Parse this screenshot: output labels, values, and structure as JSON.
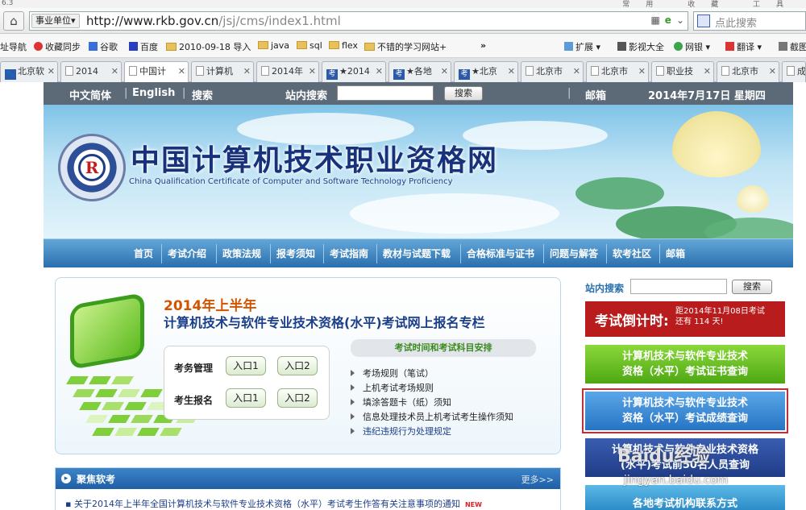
{
  "browser": {
    "top_strip_left": "6.3",
    "top_strip_right": "常用 收藏 工具",
    "zone_label": "事业单位",
    "url_host": "http://www.rkb.gov.cn",
    "url_path": "/jsj/cms/index1.html",
    "search_placeholder": "点此搜索",
    "bookmarks": [
      "址导航",
      "收藏同步",
      "谷歌",
      "百度",
      "2010-09-18 导入",
      "java",
      "sql",
      "flex",
      "不错的学习网站+",
      "»",
      "扩展",
      "影视大全",
      "网银",
      "翻译",
      "截图"
    ],
    "tabs": [
      "北京软",
      "2014",
      "中国计",
      "计算机",
      "2014年",
      "★2014",
      "★各地",
      "★北京",
      "北京市",
      "北京市",
      "职业技",
      "北京市",
      "成"
    ]
  },
  "site": {
    "top": {
      "lang_cn": "中文简体",
      "lang_en": "English",
      "search_link": "搜索",
      "search_label": "站内搜索",
      "search_btn": "搜索",
      "mail": "邮箱",
      "date": "2014年7月17日  星期四"
    },
    "banner": {
      "title": "中国计算机技术职业资格网",
      "subtitle": "China Qualification Certificate of Computer and Software Technology Proficiency",
      "logo_letter": "R"
    },
    "nav": [
      "首页",
      "考试介绍",
      "政策法规",
      "报考须知",
      "考试指南",
      "教材与试题下载",
      "合格标准与证书",
      "问题与解答",
      "软考社区",
      "邮箱"
    ],
    "promo": {
      "year": "2014年上半年",
      "title": "计算机技术与软件专业技术资格(水平)考试网上报名专栏",
      "row1_label": "考务管理",
      "row2_label": "考生报名",
      "entry1": "入口1",
      "entry2": "入口2",
      "schedule": "考试时间和考试科目安排",
      "list": [
        "考场规则（笔试）",
        "上机考试考场规则",
        "填涂答题卡（纸）须知",
        "信息处理技术员上机考试考生操作须知",
        "违纪违规行为处理规定"
      ]
    },
    "focus": {
      "title": "聚焦软考",
      "more": "更多>>",
      "news": "关于2014年上半年全国计算机技术与软件专业技术资格（水平）考试考生作答有关注意事项的通知",
      "new_badge": "NEW"
    },
    "side": {
      "search_label": "站内搜索",
      "search_btn": "搜索",
      "countdown_title": "考试倒计时:",
      "countdown_line1": "距2014年11月08日考试",
      "countdown_line2": "还有 114 天!",
      "cert_query_1": "计算机技术与软件专业技术",
      "cert_query_2": "资格（水平）考试证书查询",
      "score_query_1": "计算机技术与软件专业技术",
      "score_query_2": "资格（水平）考试成绩查询",
      "top_query_1": "计算机技术与软件专业技术资格",
      "top_query_2": "(水平)考试前50名人员查询",
      "agencies": "各地考试机构联系方式"
    },
    "watermark": "Baidu经验",
    "watermark_url": "jingyan.baidu.com"
  }
}
